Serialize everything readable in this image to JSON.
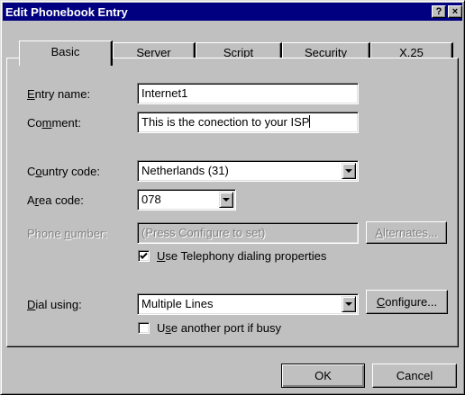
{
  "window": {
    "title": "Edit Phonebook Entry",
    "help_glyph": "?",
    "close_glyph": "×"
  },
  "tabs": [
    {
      "label": "Basic",
      "active": true
    },
    {
      "label": "Server",
      "active": false
    },
    {
      "label": "Script",
      "active": false
    },
    {
      "label": "Security",
      "active": false
    },
    {
      "label": "X.25",
      "active": false
    }
  ],
  "form": {
    "entry_name": {
      "label_pre": "",
      "label_key": "E",
      "label_post": "ntry name:",
      "value": "Internet1"
    },
    "comment": {
      "label_pre": "Co",
      "label_key": "m",
      "label_post": "ment:",
      "value": "This is the conection to your ISP"
    },
    "country_code": {
      "label_pre": "C",
      "label_key": "o",
      "label_post": "untry code:",
      "value": "Netherlands (31)"
    },
    "area_code": {
      "label_pre": "A",
      "label_key": "r",
      "label_post": "ea code:",
      "value": "078"
    },
    "phone_number": {
      "label_pre": "Phone ",
      "label_key": "n",
      "label_post": "umber:",
      "value": "(Press Configure to set)",
      "enabled": false
    },
    "alternates_button": {
      "label_pre": "",
      "label_key": "A",
      "label_post": "lternates...",
      "enabled": false
    },
    "use_telephony": {
      "label_pre": "",
      "label_key": "U",
      "label_post": "se Telephony dialing properties",
      "checked": true
    },
    "dial_using": {
      "label_pre": "",
      "label_key": "D",
      "label_post": "ial using:",
      "value": "Multiple Lines"
    },
    "configure_button": {
      "label_pre": "",
      "label_key": "C",
      "label_post": "onfigure..."
    },
    "use_another_port": {
      "label_pre": "U",
      "label_key": "s",
      "label_post": "e another port if busy",
      "checked": false
    }
  },
  "footer": {
    "ok_label": "OK",
    "cancel_label": "Cancel"
  },
  "colors": {
    "titlebar": "#000080",
    "face": "#c0c0c0"
  }
}
